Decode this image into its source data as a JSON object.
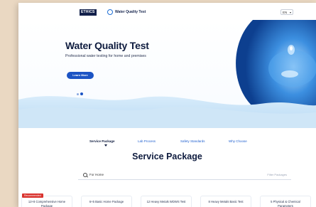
{
  "header": {
    "brand": "ETHICS",
    "site_title": "Water Quality Test",
    "language": "EN"
  },
  "hero": {
    "title": "Water Quality Test",
    "subtitle": "Professional water testing for home and premises",
    "cta_label": "Learn More"
  },
  "tabs": [
    {
      "label": "Service Package"
    },
    {
      "label": "Lab Process"
    },
    {
      "label": "Safety Standards"
    },
    {
      "label": "Why Choose"
    }
  ],
  "section": {
    "title": "Service Package",
    "search_label": "For Home",
    "filter_label": "Filter Packages"
  },
  "packages": [
    {
      "name": "12+8 Comprehensive Home Package",
      "badge": "Recommended"
    },
    {
      "name": "6+5 Basic Home Package",
      "badge": ""
    },
    {
      "name": "12 Heavy Metals WDWS Test",
      "badge": ""
    },
    {
      "name": "8 Heavy Metals Basic Test",
      "badge": ""
    },
    {
      "name": "5 Physical & Chemical Parameters",
      "badge": ""
    }
  ],
  "colors": {
    "accent": "#1c54c4",
    "navy": "#0f1c3f",
    "badge": "#d9332e",
    "water": "#3c8fe0"
  }
}
